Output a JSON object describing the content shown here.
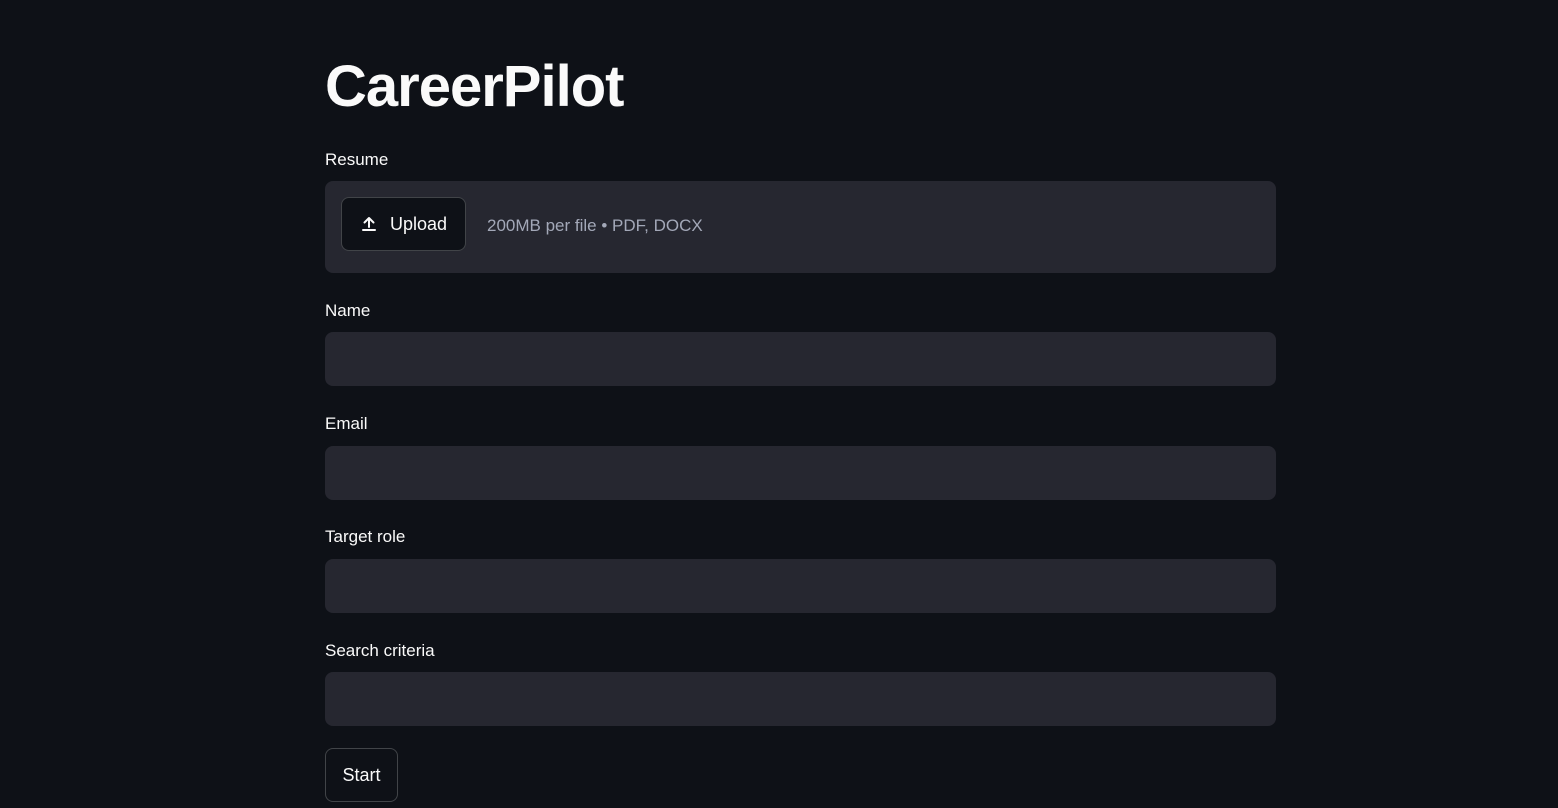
{
  "app": {
    "title": "CareerPilot"
  },
  "resume": {
    "label": "Resume",
    "upload_button_label": "Upload",
    "upload_icon": "upload-icon",
    "hint": "200MB per file • PDF, DOCX"
  },
  "fields": {
    "name": {
      "label": "Name",
      "value": "",
      "placeholder": ""
    },
    "email": {
      "label": "Email",
      "value": "",
      "placeholder": ""
    },
    "target_role": {
      "label": "Target role",
      "value": "",
      "placeholder": ""
    },
    "search_criteria": {
      "label": "Search criteria",
      "value": "",
      "placeholder": ""
    }
  },
  "actions": {
    "start_label": "Start"
  },
  "colors": {
    "background": "#0e1117",
    "input_background": "#262730",
    "text": "#fafafa",
    "muted_text": "#a3a8b8"
  }
}
